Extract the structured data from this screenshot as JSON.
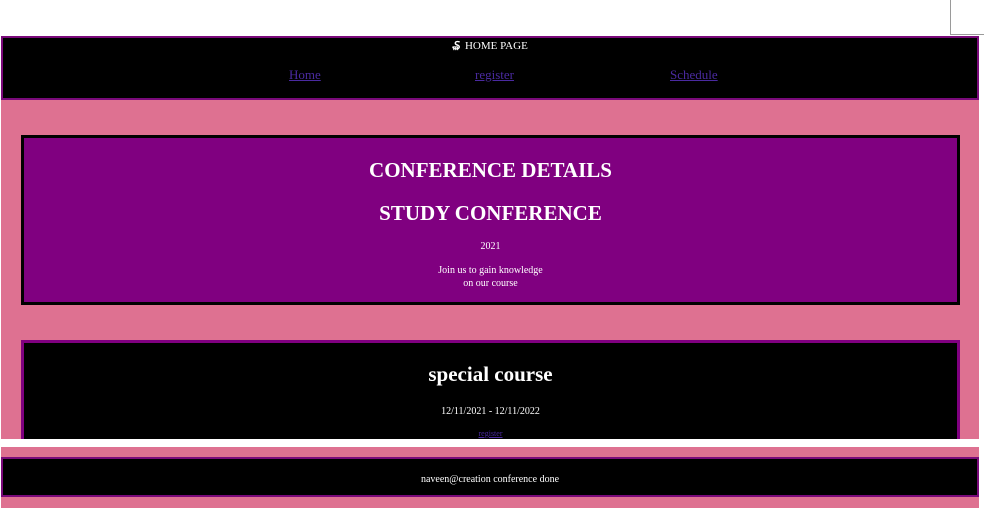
{
  "header": {
    "logo_glyph": "₷",
    "title": "HOME PAGE",
    "nav": [
      {
        "label": "Home"
      },
      {
        "label": "register"
      },
      {
        "label": "Schedule"
      }
    ]
  },
  "details": {
    "heading": "CONFERENCE DETAILS",
    "subheading": "STUDY CONFERENCE",
    "year": "2021",
    "message_line1": "Join us to gain knowledge",
    "message_line2": "on our course"
  },
  "course": {
    "title": "special course",
    "dates": "12/11/2021 - 12/11/2022",
    "register_link": "register"
  },
  "footer": {
    "text": "naveen@creation conference done"
  },
  "colors": {
    "page_background": "#de7191",
    "details_background": "#800080",
    "header_background": "#000000",
    "link": "#4a2aa0"
  }
}
